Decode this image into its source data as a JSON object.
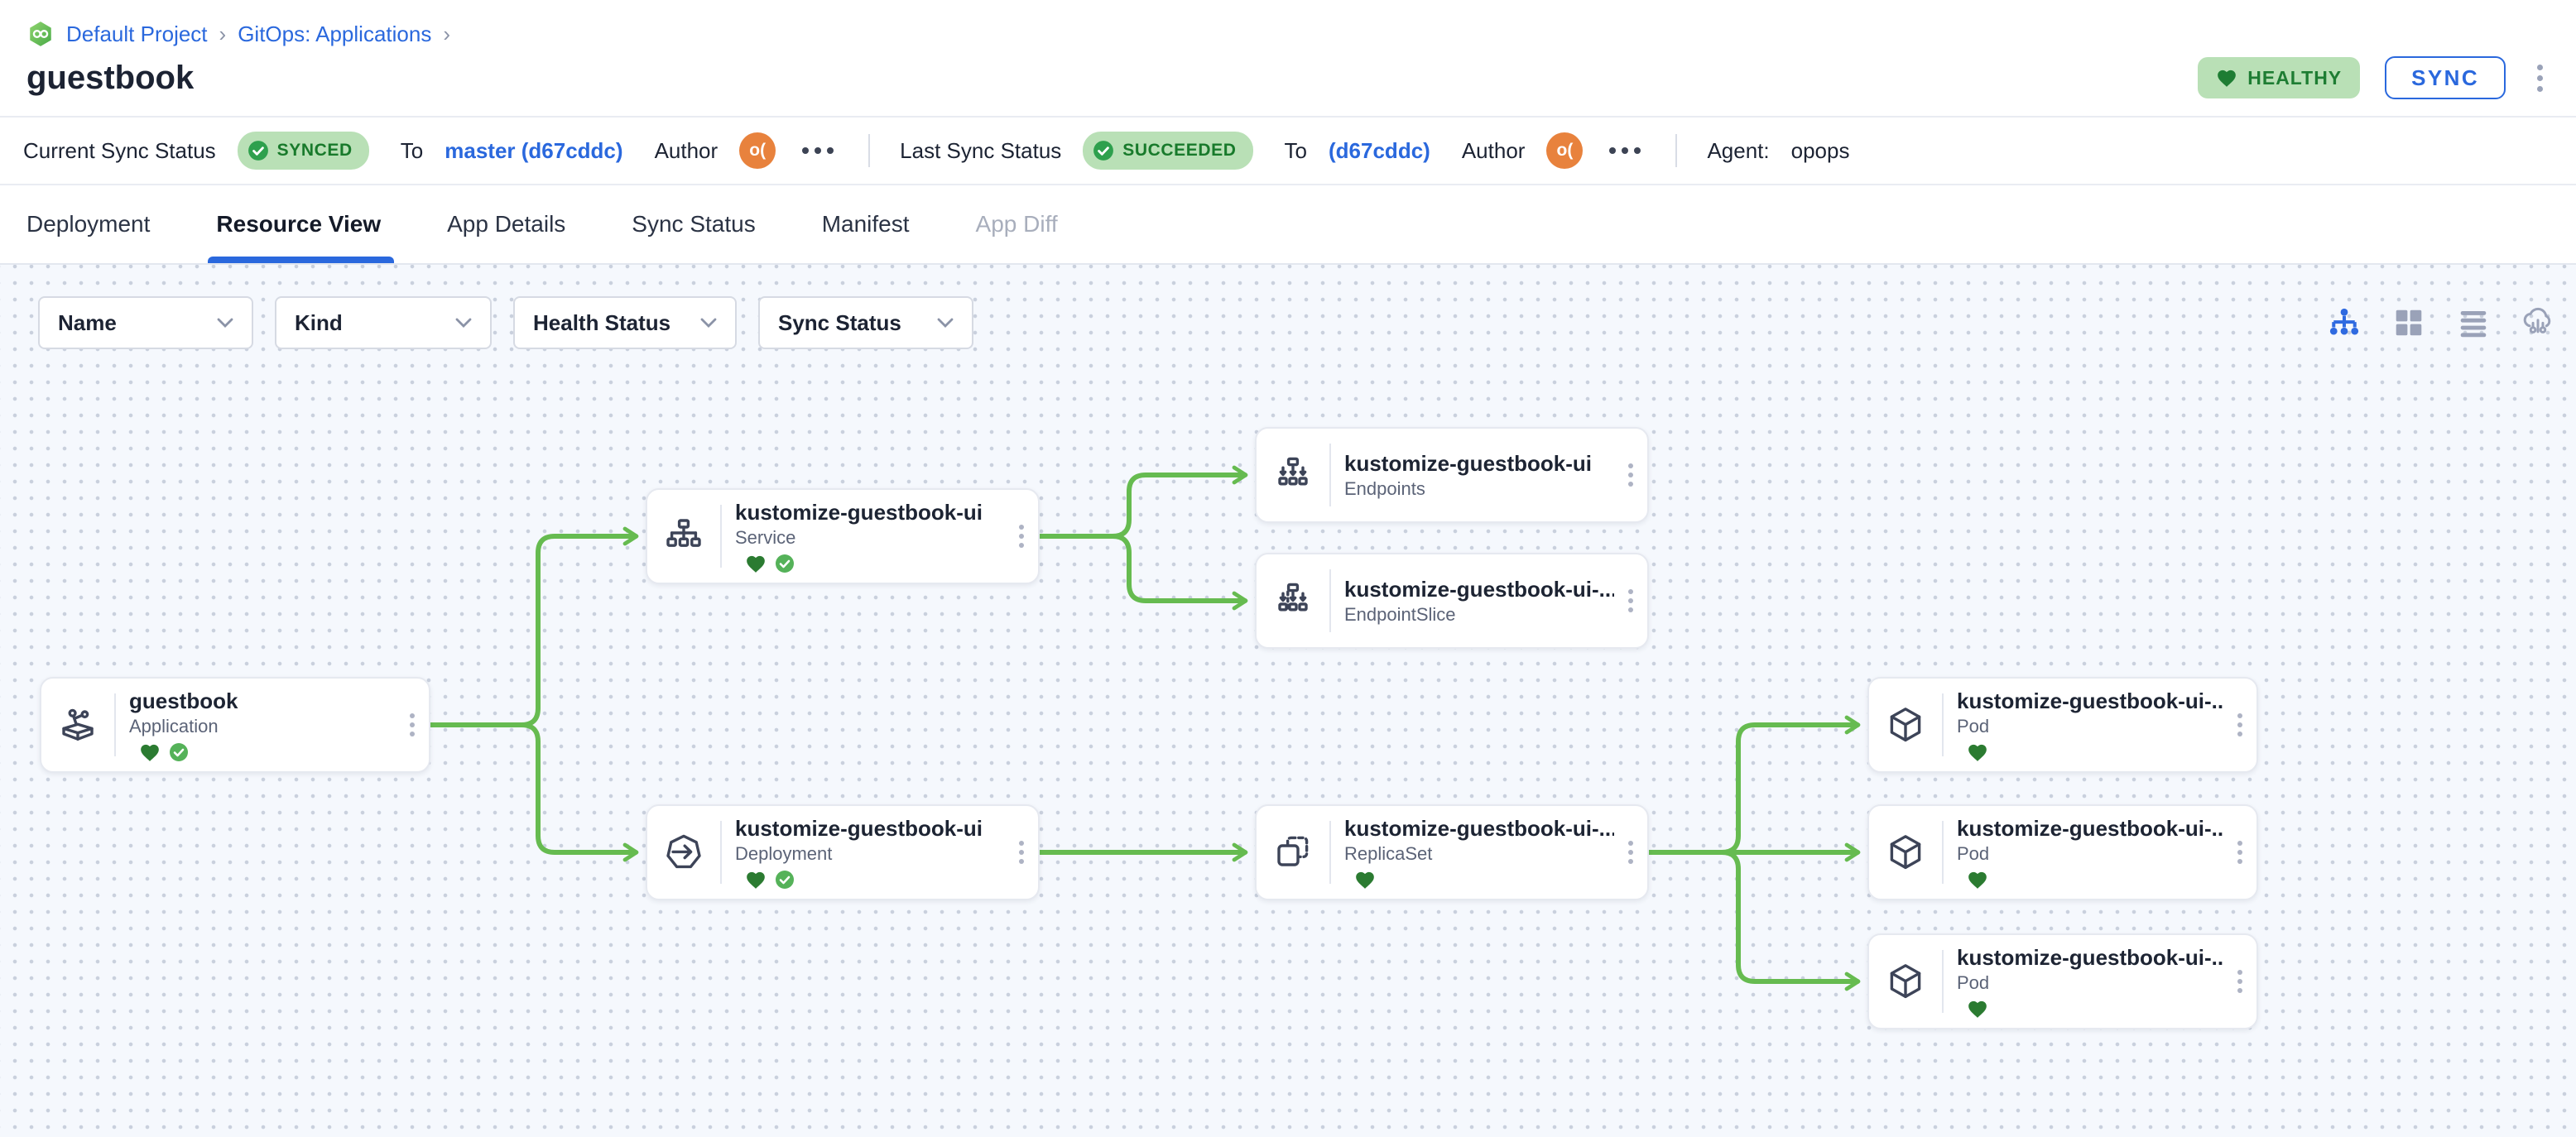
{
  "header": {
    "breadcrumb": {
      "icon": "gitops-hexagon-icon",
      "project": "Default Project",
      "separator": "›",
      "section": "GitOps: Applications"
    },
    "title": "guestbook",
    "health_badge": "HEALTHY",
    "sync_button": "SYNC"
  },
  "status_bar": {
    "current": {
      "label": "Current Sync Status",
      "badge": "SYNCED",
      "to": "To",
      "commit": "master (d67cddc)",
      "author": "Author",
      "author_initials": "o("
    },
    "last": {
      "label": "Last Sync Status",
      "badge": "SUCCEEDED",
      "to": "To",
      "commit": "(d67cddc)",
      "author": "Author",
      "author_initials": "o("
    },
    "agent": {
      "label": "Agent:",
      "value": "opops"
    }
  },
  "tabs": [
    {
      "label": "Deployment",
      "state": "default"
    },
    {
      "label": "Resource View",
      "state": "active"
    },
    {
      "label": "App Details",
      "state": "default"
    },
    {
      "label": "Sync Status",
      "state": "default"
    },
    {
      "label": "Manifest",
      "state": "default"
    },
    {
      "label": "App Diff",
      "state": "disabled"
    }
  ],
  "filters": [
    {
      "label": "Name"
    },
    {
      "label": "Kind"
    },
    {
      "label": "Health Status"
    },
    {
      "label": "Sync Status"
    }
  ],
  "view_toggles": [
    {
      "name": "tree-view-icon",
      "active": true
    },
    {
      "name": "grid-view-icon",
      "active": false
    },
    {
      "name": "list-view-icon",
      "active": false
    },
    {
      "name": "cloud-view-icon",
      "active": false
    }
  ],
  "graph": {
    "nodes": [
      {
        "id": "app",
        "name": "guestbook",
        "kind": "Application",
        "icon": "application-icon",
        "health": [
          "healthy",
          "synced"
        ]
      },
      {
        "id": "svc",
        "name": "kustomize-guestbook-ui",
        "kind": "Service",
        "icon": "service-icon",
        "health": [
          "healthy",
          "synced"
        ]
      },
      {
        "id": "ep",
        "name": "kustomize-guestbook-ui",
        "kind": "Endpoints",
        "icon": "endpoints-icon",
        "health": []
      },
      {
        "id": "eps",
        "name": "kustomize-guestbook-ui-...",
        "kind": "EndpointSlice",
        "icon": "endpointslice-icon",
        "health": []
      },
      {
        "id": "dep",
        "name": "kustomize-guestbook-ui",
        "kind": "Deployment",
        "icon": "deployment-icon",
        "health": [
          "healthy",
          "synced"
        ]
      },
      {
        "id": "rs",
        "name": "kustomize-guestbook-ui-...",
        "kind": "ReplicaSet",
        "icon": "replicaset-icon",
        "health": [
          "healthy"
        ]
      },
      {
        "id": "pod1",
        "name": "kustomize-guestbook-ui-...",
        "kind": "Pod",
        "icon": "pod-icon",
        "health": [
          "healthy"
        ]
      },
      {
        "id": "pod2",
        "name": "kustomize-guestbook-ui-...",
        "kind": "Pod",
        "icon": "pod-icon",
        "health": [
          "healthy"
        ]
      },
      {
        "id": "pod3",
        "name": "kustomize-guestbook-ui-...",
        "kind": "Pod",
        "icon": "pod-icon",
        "health": [
          "healthy"
        ]
      }
    ],
    "edges": [
      [
        "app",
        "svc"
      ],
      [
        "app",
        "dep"
      ],
      [
        "svc",
        "ep"
      ],
      [
        "svc",
        "eps"
      ],
      [
        "dep",
        "rs"
      ],
      [
        "rs",
        "pod1"
      ],
      [
        "rs",
        "pod2"
      ],
      [
        "rs",
        "pod3"
      ]
    ]
  },
  "colors": {
    "accent_blue": "#2a68dd",
    "healthy_green": "#2b7b31",
    "badge_bg": "#b9e0b6",
    "badge_text": "#187a2b",
    "badge_check_green": "#2ea04d",
    "edge_green": "#66bb50",
    "avatar_orange": "#e8823d"
  }
}
